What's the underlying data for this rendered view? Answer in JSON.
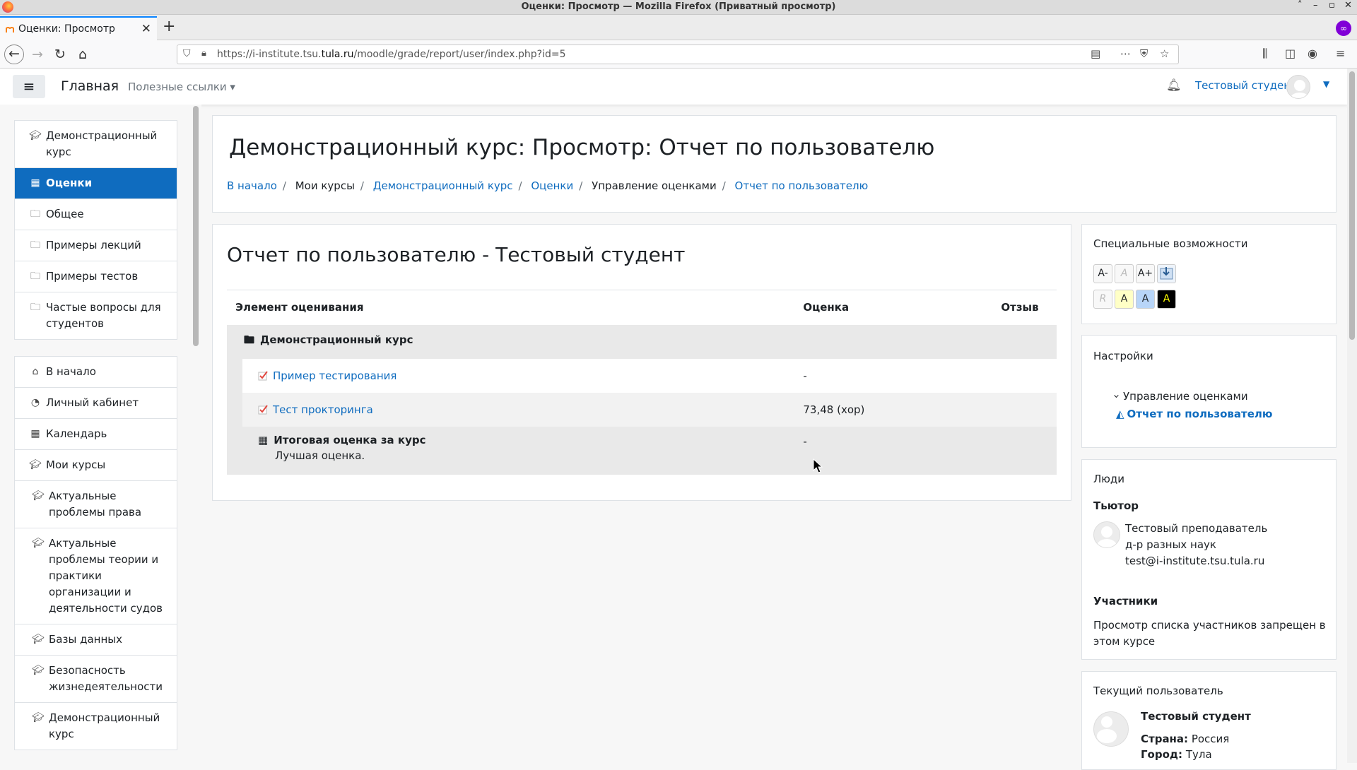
{
  "window": {
    "title": "Оценки: Просмотр — Mozilla Firefox (Приватный просмотр)",
    "controls": [
      "˄",
      "–",
      "▫",
      "✕"
    ]
  },
  "tab": {
    "title": "Оценки: Просмотр",
    "close": "✕",
    "new_tab": "+"
  },
  "toolbar": {
    "url_prefix": "https://i-institute.tsu.",
    "url_domain": "tula.ru",
    "url_suffix": "/moodle/grade/report/user/index.php?id=5"
  },
  "moodle_nav": {
    "menu_icon": "≡",
    "home": "Главная",
    "useful_links": "Полезные ссылки ▾",
    "user_name": "Тестовый студент",
    "user_caret": "▼"
  },
  "drawer": {
    "group1": [
      {
        "icon": "graduation-cap-icon",
        "label": "Демонстрационный курс",
        "active": false
      },
      {
        "icon": "table-icon",
        "label": "Оценки",
        "active": true
      },
      {
        "icon": "folder-icon",
        "label": "Общее",
        "active": false
      },
      {
        "icon": "folder-icon",
        "label": "Примеры лекций",
        "active": false
      },
      {
        "icon": "folder-icon",
        "label": "Примеры тестов",
        "active": false
      },
      {
        "icon": "folder-icon",
        "label": "Частые вопросы для студентов",
        "active": false
      }
    ],
    "group2": [
      {
        "icon": "home-icon",
        "label": "В начало"
      },
      {
        "icon": "dashboard-icon",
        "label": "Личный кабинет"
      },
      {
        "icon": "calendar-icon",
        "label": "Календарь"
      },
      {
        "icon": "graduation-cap-icon",
        "label": "Мои курсы"
      },
      {
        "icon": "graduation-cap-icon",
        "label": "Актуальные проблемы права"
      },
      {
        "icon": "graduation-cap-icon",
        "label": "Актуальные проблемы теории и практики организации и деятельности судов"
      },
      {
        "icon": "graduation-cap-icon",
        "label": "Базы данных"
      },
      {
        "icon": "graduation-cap-icon",
        "label": "Безопасность жизнедеятельности"
      },
      {
        "icon": "graduation-cap-icon",
        "label": "Демонстрационный курс"
      }
    ]
  },
  "header": {
    "title": "Демонстрационный курс: Просмотр: Отчет по пользователю",
    "breadcrumb": [
      {
        "label": "В начало",
        "link": true
      },
      {
        "label": "Мои курсы",
        "link": false
      },
      {
        "label": "Демонстрационный курс",
        "link": true
      },
      {
        "label": "Оценки",
        "link": true
      },
      {
        "label": "Управление оценками",
        "link": false
      },
      {
        "label": "Отчет по пользователю",
        "link": true
      }
    ]
  },
  "report": {
    "title": "Отчет по пользователю - Тестовый студент",
    "columns": [
      "Элемент оценивания",
      "Оценка",
      "Отзыв"
    ],
    "category": "Демонстрационный курс",
    "rows": [
      {
        "name": "Пример тестирования",
        "grade": "-",
        "feedback": ""
      },
      {
        "name": "Тест прокторинга",
        "grade": "73,48 (хор)",
        "feedback": ""
      }
    ],
    "total": {
      "name": "Итоговая оценка за курс",
      "note": "Лучшая оценка.",
      "grade": "-"
    }
  },
  "accessibility": {
    "title": "Специальные возможности",
    "buttons_row1": [
      "A-",
      "A",
      "A+"
    ],
    "buttons_row2": [
      "R",
      "A",
      "A",
      "A"
    ]
  },
  "settings": {
    "title": "Настройки",
    "node": "Управление оценками",
    "node_caret": "›",
    "active_link": "Отчет по пользователю"
  },
  "people": {
    "title": "Люди",
    "tutor_heading": "Тьютор",
    "tutor_name": "Тестовый преподаватель",
    "tutor_degree": "д-р разных наук",
    "tutor_email": "test@i-institute.tsu.tula.ru",
    "participants_heading": "Участники",
    "participants_text": "Просмотр списка участников запрещен в этом курсе"
  },
  "current_user": {
    "title": "Текущий пользователь",
    "name": "Тестовый студент",
    "country_label": "Страна:",
    "country": "Россия",
    "city_label": "Город:",
    "city": "Тула"
  },
  "colors": {
    "accent": "#0f6cbf",
    "firefox_private": "#8000d7"
  }
}
